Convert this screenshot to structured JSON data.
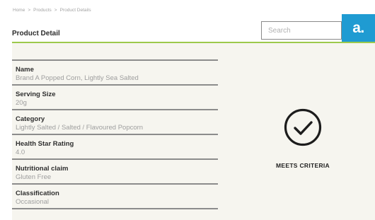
{
  "breadcrumb": {
    "items": [
      "Home",
      "Products",
      "Product Details"
    ],
    "separator": ">"
  },
  "page": {
    "title": "Product Detail"
  },
  "search": {
    "placeholder": "Search",
    "value": ""
  },
  "badge": {
    "label": "a."
  },
  "details": [
    {
      "label": "Name",
      "value": "Brand A Popped Corn, Lightly Sea Salted"
    },
    {
      "label": "Serving Size",
      "value": "20g"
    },
    {
      "label": "Category",
      "value": "Lightly Salted / Salted / Flavoured Popcorn"
    },
    {
      "label": "Health Star Rating",
      "value": "4.0"
    },
    {
      "label": "Nutritional claim",
      "value": "Gluten Free"
    },
    {
      "label": "Classification",
      "value": "Occasional"
    }
  ],
  "status": {
    "icon": "check-circle-icon",
    "label": "MEETS CRITERIA"
  },
  "colors": {
    "accent_line": "#9cc94b",
    "badge_bg": "#1f9bd2",
    "panel_bg": "#f6f5ef"
  }
}
